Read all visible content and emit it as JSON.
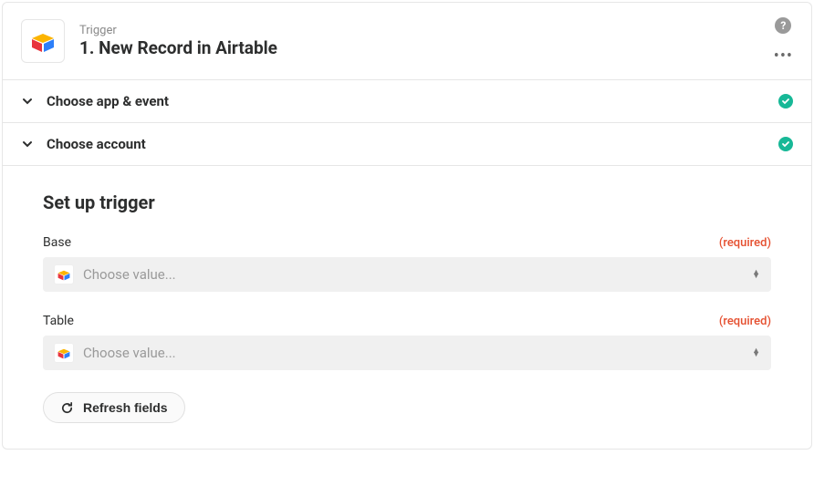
{
  "header": {
    "label": "Trigger",
    "title": "1. New Record in Airtable"
  },
  "sections": {
    "appEvent": "Choose app & event",
    "account": "Choose account"
  },
  "setup": {
    "heading": "Set up trigger",
    "fields": {
      "base": {
        "label": "Base",
        "required": "(required)",
        "placeholder": "Choose value..."
      },
      "table": {
        "label": "Table",
        "required": "(required)",
        "placeholder": "Choose value..."
      }
    },
    "refresh": "Refresh fields"
  }
}
